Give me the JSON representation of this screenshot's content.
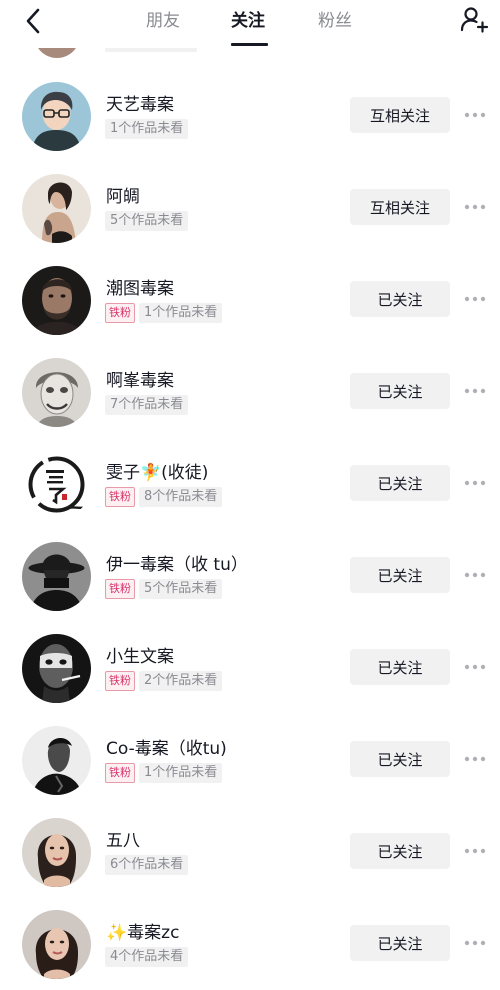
{
  "header": {
    "tabs": [
      {
        "label": "朋友",
        "active": false
      },
      {
        "label": "关注",
        "active": true
      },
      {
        "label": "粉丝",
        "active": false
      }
    ]
  },
  "users": [
    {
      "name": "天艺毒案",
      "badge": "",
      "unread": "1个作品未看",
      "button": "互相关注",
      "avatar": "cartoon-man-glasses"
    },
    {
      "name": "阿皗",
      "badge": "",
      "unread": "5个作品未看",
      "button": "互相关注",
      "avatar": "woman-tattoo-photo"
    },
    {
      "name": "潮图毒案",
      "badge": "铁粉",
      "unread": "1个作品未看",
      "button": "已关注",
      "avatar": "bearded-man-portrait"
    },
    {
      "name": "啊峯毒案",
      "badge": "",
      "unread": "7个作品未看",
      "button": "已关注",
      "avatar": "joker-sketch"
    },
    {
      "name": "雯子🧚(收徒)",
      "badge": "铁粉",
      "unread": "8个作品未看",
      "button": "已关注",
      "avatar": "calligraphy-logo"
    },
    {
      "name": "伊一毒案（收 tu）",
      "badge": "铁粉",
      "unread": "5个作品未看",
      "button": "已关注",
      "avatar": "hat-man-silhouette"
    },
    {
      "name": "小生文案",
      "badge": "铁粉",
      "unread": "2个作品未看",
      "button": "已关注",
      "avatar": "masked-man-smoking"
    },
    {
      "name": "Co-毒案（收tu)",
      "badge": "铁粉",
      "unread": "1个作品未看",
      "button": "已关注",
      "avatar": "man-dark-portrait"
    },
    {
      "name": "五八",
      "badge": "",
      "unread": "6个作品未看",
      "button": "已关注",
      "avatar": "woman-portrait"
    },
    {
      "name": "✨毒案zc",
      "badge": "",
      "unread": "4个作品未看",
      "button": "已关注",
      "avatar": "woman-portrait-2"
    }
  ],
  "colors": {
    "text": "#161823",
    "muted": "#8a8b91",
    "button_bg": "#f1f1f2",
    "badge": "#d6336c"
  }
}
